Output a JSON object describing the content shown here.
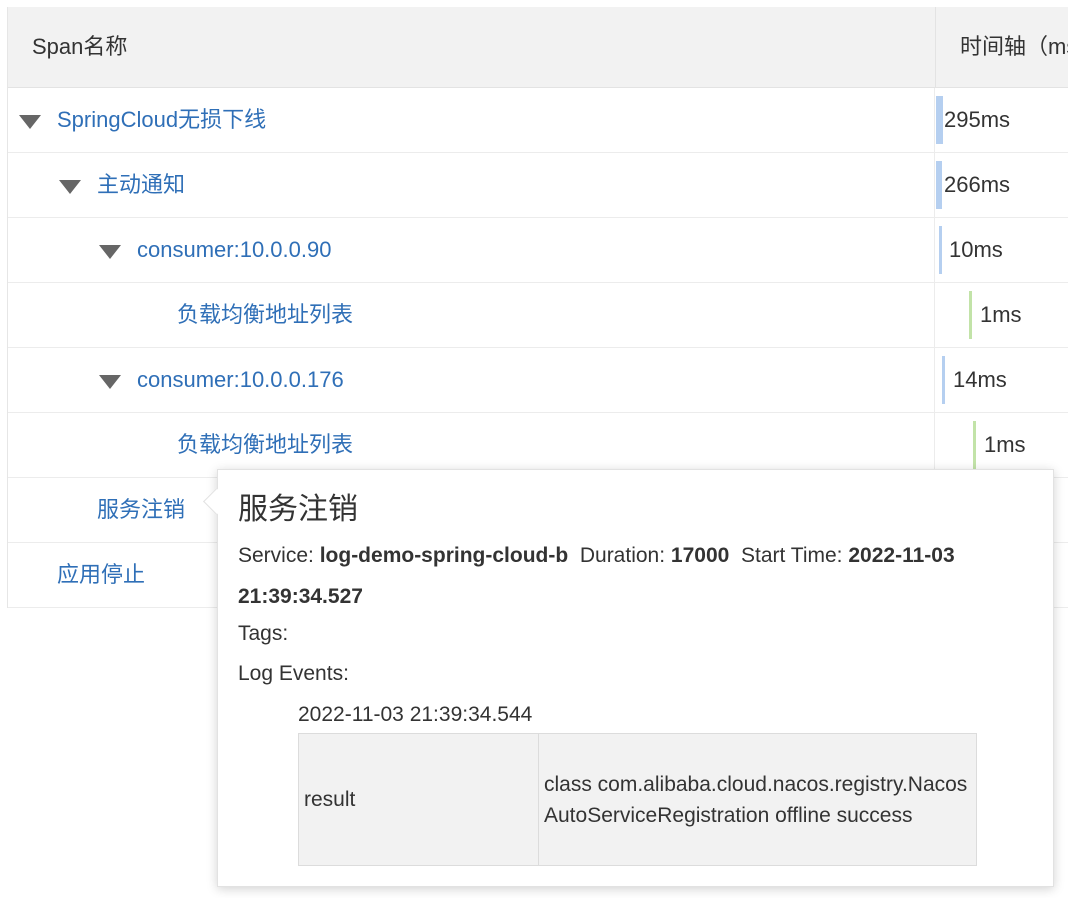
{
  "table": {
    "headers": {
      "name": "Span名称",
      "timeline": "时间轴（ms）"
    },
    "rows": [
      {
        "label": "SpringCloud无损下线",
        "duration": "295ms",
        "bar_color": "#b5cff0"
      },
      {
        "label": "主动通知",
        "duration": "266ms",
        "bar_color": "#b5cff0"
      },
      {
        "label": "consumer:10.0.0.90",
        "duration": "10ms",
        "bar_color": "#b5cff0"
      },
      {
        "label": "负载均衡地址列表",
        "duration": "1ms",
        "bar_color": "#c2e3a8"
      },
      {
        "label": "consumer:10.0.0.176",
        "duration": "14ms",
        "bar_color": "#b5cff0"
      },
      {
        "label": "负载均衡地址列表",
        "duration": "1ms",
        "bar_color": "#c2e3a8"
      },
      {
        "label": "服务注销",
        "duration": ""
      },
      {
        "label": "应用停止",
        "duration": ""
      }
    ]
  },
  "tooltip": {
    "title": "服务注销",
    "service_label": "Service:",
    "service": "log-demo-spring-cloud-b",
    "duration_label": "Duration:",
    "duration": "17000",
    "start_label": "Start Time:",
    "start_time": "2022-11-03 21:39:34.527",
    "tags_label": "Tags:",
    "log_events_label": "Log Events:",
    "events": [
      {
        "time": "2022-11-03 21:39:34.544",
        "key": "result",
        "value": "class com.alibaba.cloud.nacos.registry.NacosAutoServiceRegistration offline success"
      }
    ]
  },
  "colors": {
    "link": "#2f6fb7",
    "header_bg": "#f2f2f2",
    "bar_blue": "#b5cff0",
    "bar_green": "#c2e3a8"
  }
}
